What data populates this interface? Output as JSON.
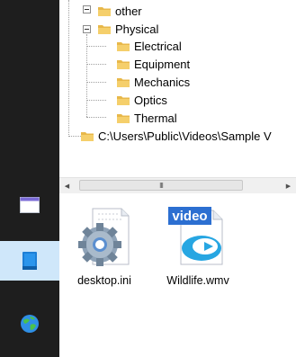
{
  "taskbar": {
    "items": [
      {
        "icon": "window-icon"
      },
      {
        "icon": "book-icon",
        "active": true
      },
      {
        "icon": "globe-icon"
      }
    ]
  },
  "tree": {
    "items": [
      {
        "label": "other"
      },
      {
        "label": "Physical"
      },
      {
        "label": "Electrical"
      },
      {
        "label": "Equipment"
      },
      {
        "label": "Mechanics"
      },
      {
        "label": "Optics"
      },
      {
        "label": "Thermal"
      },
      {
        "label": "C:\\Users\\Public\\Videos\\Sample V"
      }
    ]
  },
  "scrollbar": {
    "thumb_grip": "III"
  },
  "files": [
    {
      "name": "desktop.ini",
      "icon": "settings-file-icon"
    },
    {
      "name": "Wildlife.wmv",
      "icon": "video-file-icon",
      "badge": "video"
    }
  ],
  "colors": {
    "taskbar_bg": "#1e1e1e",
    "active_taskbar_item": "#cfe7fa",
    "folder": "#e8b84a"
  }
}
